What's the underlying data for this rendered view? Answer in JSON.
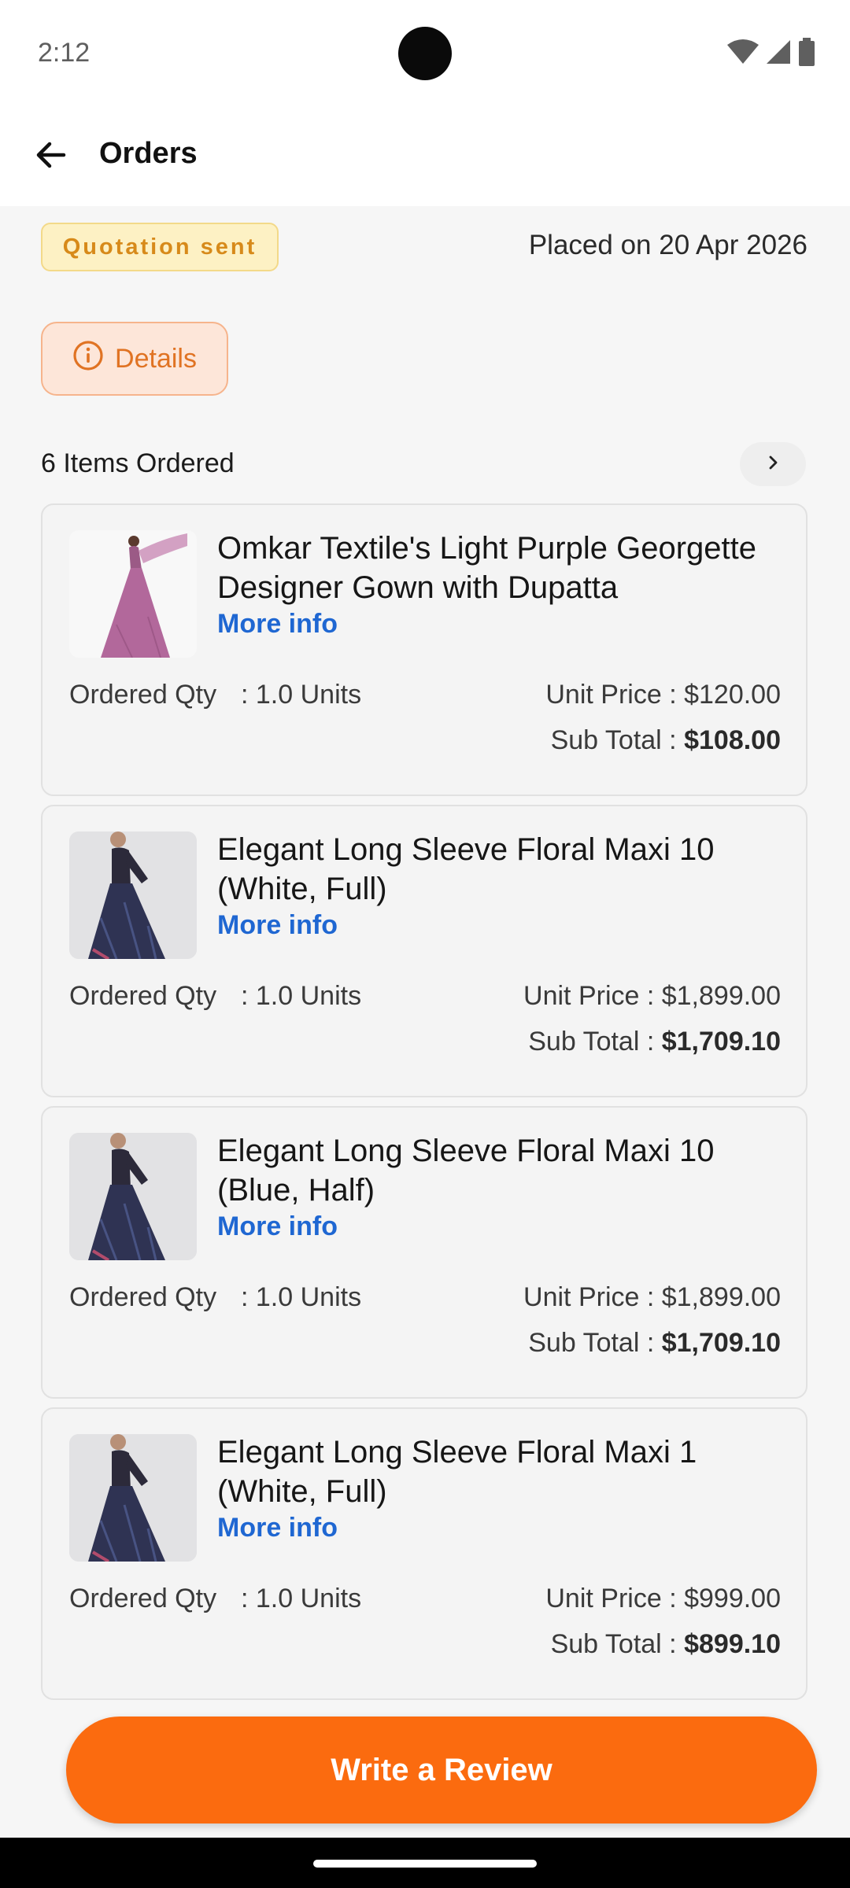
{
  "status_bar": {
    "time": "2:12"
  },
  "app_bar": {
    "title": "Orders"
  },
  "order": {
    "status_badge": "Quotation sent",
    "placed_on": "Placed on 20 Apr 2026",
    "details_label": "Details",
    "items_ordered_label": "6 Items Ordered"
  },
  "items": [
    {
      "title": "Omkar Textile's Light Purple Georgette Designer Gown with Dupatta",
      "more_info": "More info",
      "qty_label": "Ordered Qty",
      "qty_value": ": 1.0 Units",
      "unit_price": "Unit Price : $120.00",
      "sub_total_label": "Sub Total : ",
      "sub_total_value": "$108.00",
      "image": "purple-gown-thumbnail"
    },
    {
      "title": "Elegant Long Sleeve Floral Maxi 10 (White, Full)",
      "more_info": "More info",
      "qty_label": "Ordered Qty",
      "qty_value": ": 1.0 Units",
      "unit_price": "Unit Price : $1,899.00",
      "sub_total_label": "Sub Total : ",
      "sub_total_value": "$1,709.10",
      "image": "floral-maxi-thumbnail"
    },
    {
      "title": "Elegant Long Sleeve Floral Maxi 10 (Blue, Half)",
      "more_info": "More info",
      "qty_label": "Ordered Qty",
      "qty_value": ": 1.0 Units",
      "unit_price": "Unit Price : $1,899.00",
      "sub_total_label": "Sub Total : ",
      "sub_total_value": "$1,709.10",
      "image": "floral-maxi-thumbnail"
    },
    {
      "title": "Elegant Long Sleeve Floral Maxi 1 (White, Full)",
      "more_info": "More info",
      "qty_label": "Ordered Qty",
      "qty_value": ": 1.0 Units",
      "unit_price": "Unit Price : $999.00",
      "sub_total_label": "Sub Total : ",
      "sub_total_value": "$899.10",
      "image": "floral-maxi-thumbnail"
    }
  ],
  "review_button": {
    "label": "Write a Review"
  },
  "colors": {
    "accent": "#fb6b0f",
    "link": "#1f67d2",
    "badge_text": "#d78a1a",
    "badge_bg": "#fdf1c4",
    "details_text": "#e07323"
  },
  "icons": {
    "back": "arrow-left-icon",
    "details": "info-circle-icon",
    "chevron": "chevron-right-icon",
    "wifi": "wifi-icon",
    "signal": "cell-signal-icon",
    "battery": "battery-icon"
  }
}
